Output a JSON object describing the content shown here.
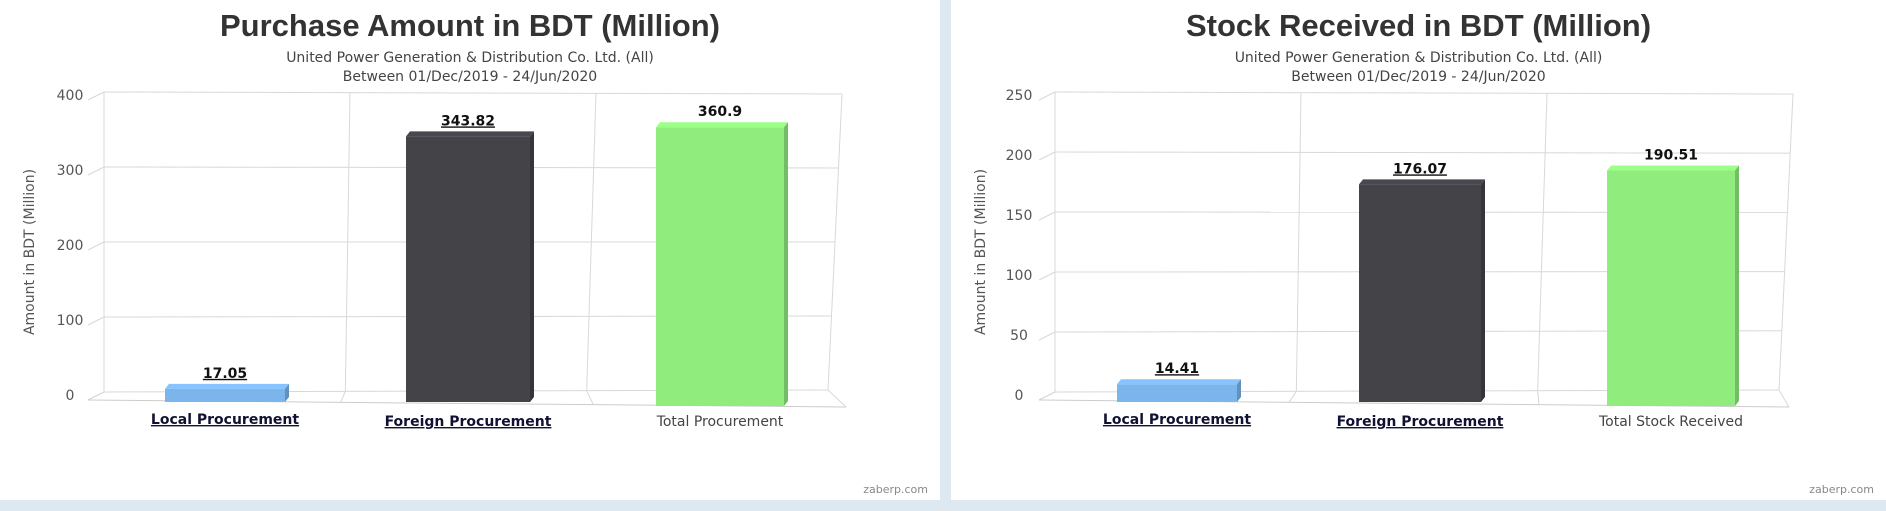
{
  "credits": "zaberp.com",
  "chart_data": [
    {
      "type": "bar",
      "title": "Purchase Amount in BDT (Million)",
      "subtitle_line1": "United Power Generation & Distribution Co. Ltd. (All)",
      "subtitle_line2": "Between 01/Dec/2019 - 24/Jun/2020",
      "ylabel": "Amount in BDT (Million)",
      "xlabel": "",
      "ylim": [
        0,
        400
      ],
      "yticks": [
        0,
        100,
        200,
        300,
        400
      ],
      "ytick_labels": [
        "0",
        "100",
        "200",
        "300",
        "400"
      ],
      "grid": true,
      "categories": [
        "Local Procurement",
        "Foreign Procurement",
        "Total Procurement"
      ],
      "category_links": [
        true,
        true,
        false
      ],
      "values": [
        17.05,
        343.82,
        360.9
      ],
      "value_labels": [
        "17.05",
        "343.82",
        "360.9"
      ],
      "colors": [
        "#7cb5ec",
        "#434348",
        "#90ed7d"
      ]
    },
    {
      "type": "bar",
      "title": "Stock Received in BDT (Million)",
      "subtitle_line1": "United Power Generation & Distribution Co. Ltd. (All)",
      "subtitle_line2": "Between 01/Dec/2019 - 24/Jun/2020",
      "ylabel": "Amount in BDT (Million)",
      "xlabel": "",
      "ylim": [
        0,
        250
      ],
      "yticks": [
        0,
        50,
        100,
        150,
        200,
        250
      ],
      "ytick_labels": [
        "0",
        "50",
        "100",
        "150",
        "200",
        "250"
      ],
      "grid": true,
      "categories": [
        "Local Procurement",
        "Foreign Procurement",
        "Total Stock Received"
      ],
      "category_links": [
        true,
        true,
        false
      ],
      "values": [
        14.41,
        176.07,
        190.51
      ],
      "value_labels": [
        "14.41",
        "176.07",
        "190.51"
      ],
      "colors": [
        "#7cb5ec",
        "#434348",
        "#90ed7d"
      ]
    }
  ]
}
